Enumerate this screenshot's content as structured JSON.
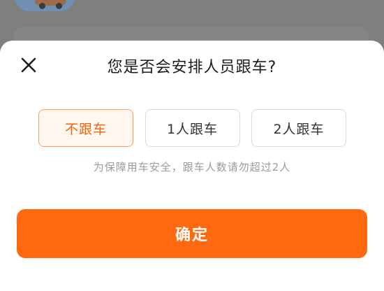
{
  "dialog": {
    "title": "您是否会安排人员跟车?",
    "close_icon": "close-icon",
    "options": [
      {
        "label": "不跟车",
        "selected": true
      },
      {
        "label": "1人跟车",
        "selected": false
      },
      {
        "label": "2人跟车",
        "selected": false
      }
    ],
    "hint": "为保障用车安全，跟车人数请勿超过2人",
    "confirm_label": "确定"
  },
  "colors": {
    "accent": "#ff6a10",
    "selected_text": "#f2650f",
    "selected_border": "#f7a063",
    "selected_bg": "#fff6ef",
    "overlay": "#7f7f7f"
  }
}
